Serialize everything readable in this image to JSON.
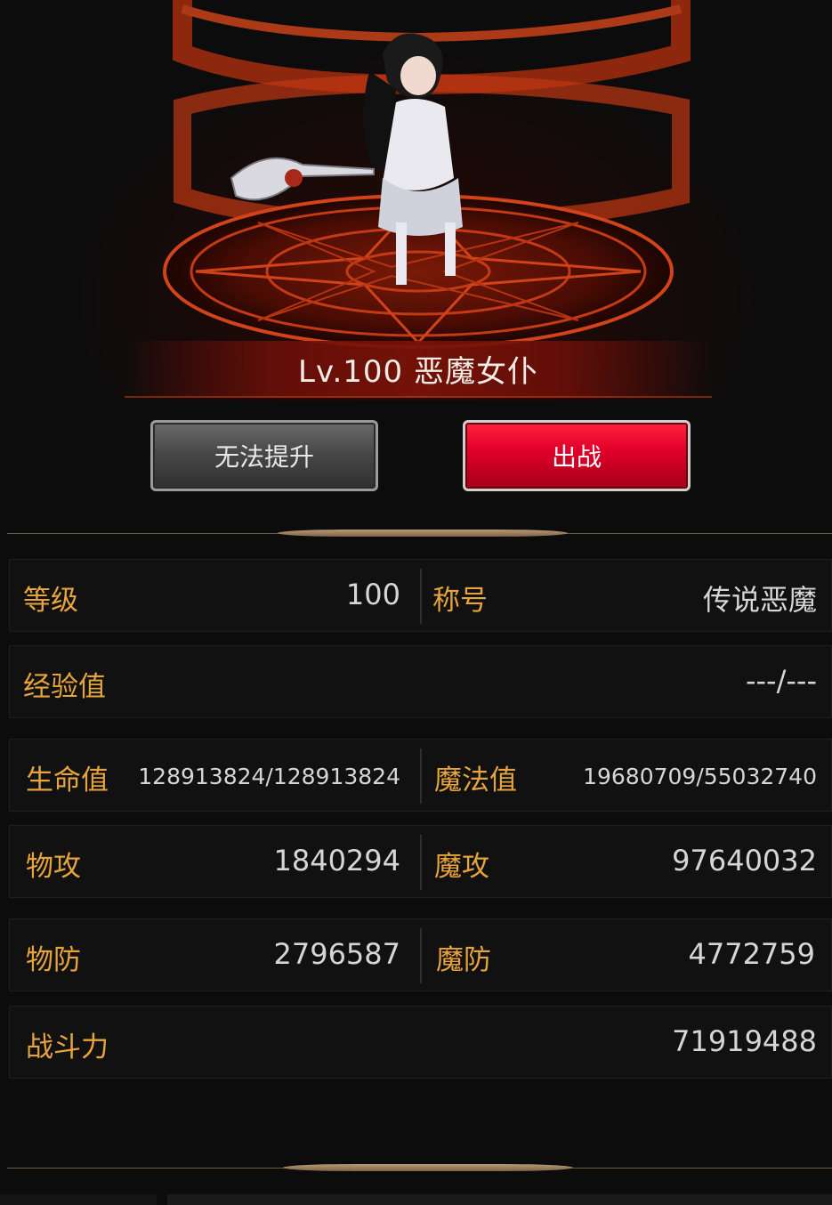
{
  "hero": {
    "title": "Lv.100 恶魔女仆"
  },
  "buttons": {
    "upgrade_label": "无法提升",
    "deploy_label": "出战"
  },
  "stats": {
    "level_label": "等级",
    "level_value": "100",
    "title_label": "称号",
    "title_value": "传说恶魔",
    "exp_label": "经验值",
    "exp_value": "---/---",
    "hp_label": "生命值",
    "hp_value": "128913824/128913824",
    "mp_label": "魔法值",
    "mp_value": "19680709/55032740",
    "patk_label": "物攻",
    "patk_value": "1840294",
    "matk_label": "魔攻",
    "matk_value": "97640032",
    "pdef_label": "物防",
    "pdef_value": "2796587",
    "mdef_label": "魔防",
    "mdef_value": "4772759",
    "power_label": "战斗力",
    "power_value": "71919488"
  },
  "colors": {
    "label": "#e7a43c",
    "value": "#d6d6d6",
    "deploy_button": "#e3002a",
    "upgrade_button": "#484848",
    "circle": "#c93413"
  },
  "icons": {
    "character": "demon-maid-sprite",
    "magic_circle": "summoning-circle-icon"
  }
}
